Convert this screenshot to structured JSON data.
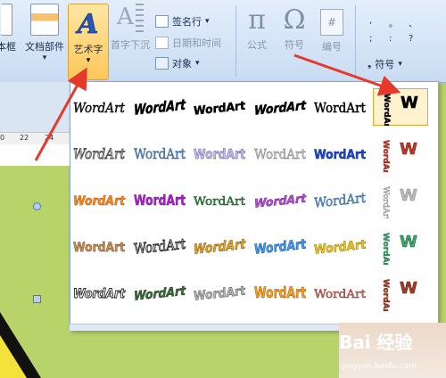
{
  "ribbon": {
    "text_box_partial": "本框",
    "quick_parts": "文档部件",
    "wordart": "艺术字",
    "drop_cap": "首字下沉",
    "signature_line": "签名行",
    "date_time": "日期和时间",
    "object": "对象",
    "formula": "公式",
    "symbol": "符号",
    "number": "编号",
    "symbol_small": "符号",
    "dropdown_arrow": "▾"
  },
  "ruler": {
    "ticks": [
      "0",
      "22",
      "24"
    ]
  },
  "gallery": {
    "label": "WordArt",
    "rows": [
      [
        {
          "style": "s-plain-italic"
        },
        {
          "style": "s-arch-black"
        },
        {
          "style": "s-wave-black"
        },
        {
          "style": "s-slant-black"
        },
        {
          "style": "s-serif"
        },
        {
          "style": "s-vertical-small"
        }
      ],
      [
        {
          "style": "s-outline-gray"
        },
        {
          "style": "s-blue-serif"
        },
        {
          "style": "s-purple-outline"
        },
        {
          "style": "s-gray-shadow"
        },
        {
          "style": "s-blue-bold"
        },
        {
          "style": "s-vertical-red"
        }
      ],
      [
        {
          "style": "s-rainbow"
        },
        {
          "style": "s-purple-bold"
        },
        {
          "style": "s-green-shadow"
        },
        {
          "style": "s-purple-wave"
        },
        {
          "style": "s-blue-arch"
        },
        {
          "style": "s-vertical-gray"
        }
      ],
      [
        {
          "style": "s-brown"
        },
        {
          "style": "s-gray-wave"
        },
        {
          "style": "s-gold-wave"
        },
        {
          "style": "s-blue-3d"
        },
        {
          "style": "s-gold-slant"
        },
        {
          "style": "s-vertical-color"
        }
      ],
      [
        {
          "style": "s-gray-3d"
        },
        {
          "style": "s-green-3d"
        },
        {
          "style": "s-silver-3d"
        },
        {
          "style": "s-orange-3d"
        },
        {
          "style": "s-red-gray"
        },
        {
          "style": "s-vertical-brown"
        }
      ]
    ]
  },
  "watermark": {
    "logo": "Bai 经验",
    "url": "jingyan.baidu.com"
  },
  "colors": {
    "arrow": "#e5392b",
    "accent": "#f2b33b"
  }
}
